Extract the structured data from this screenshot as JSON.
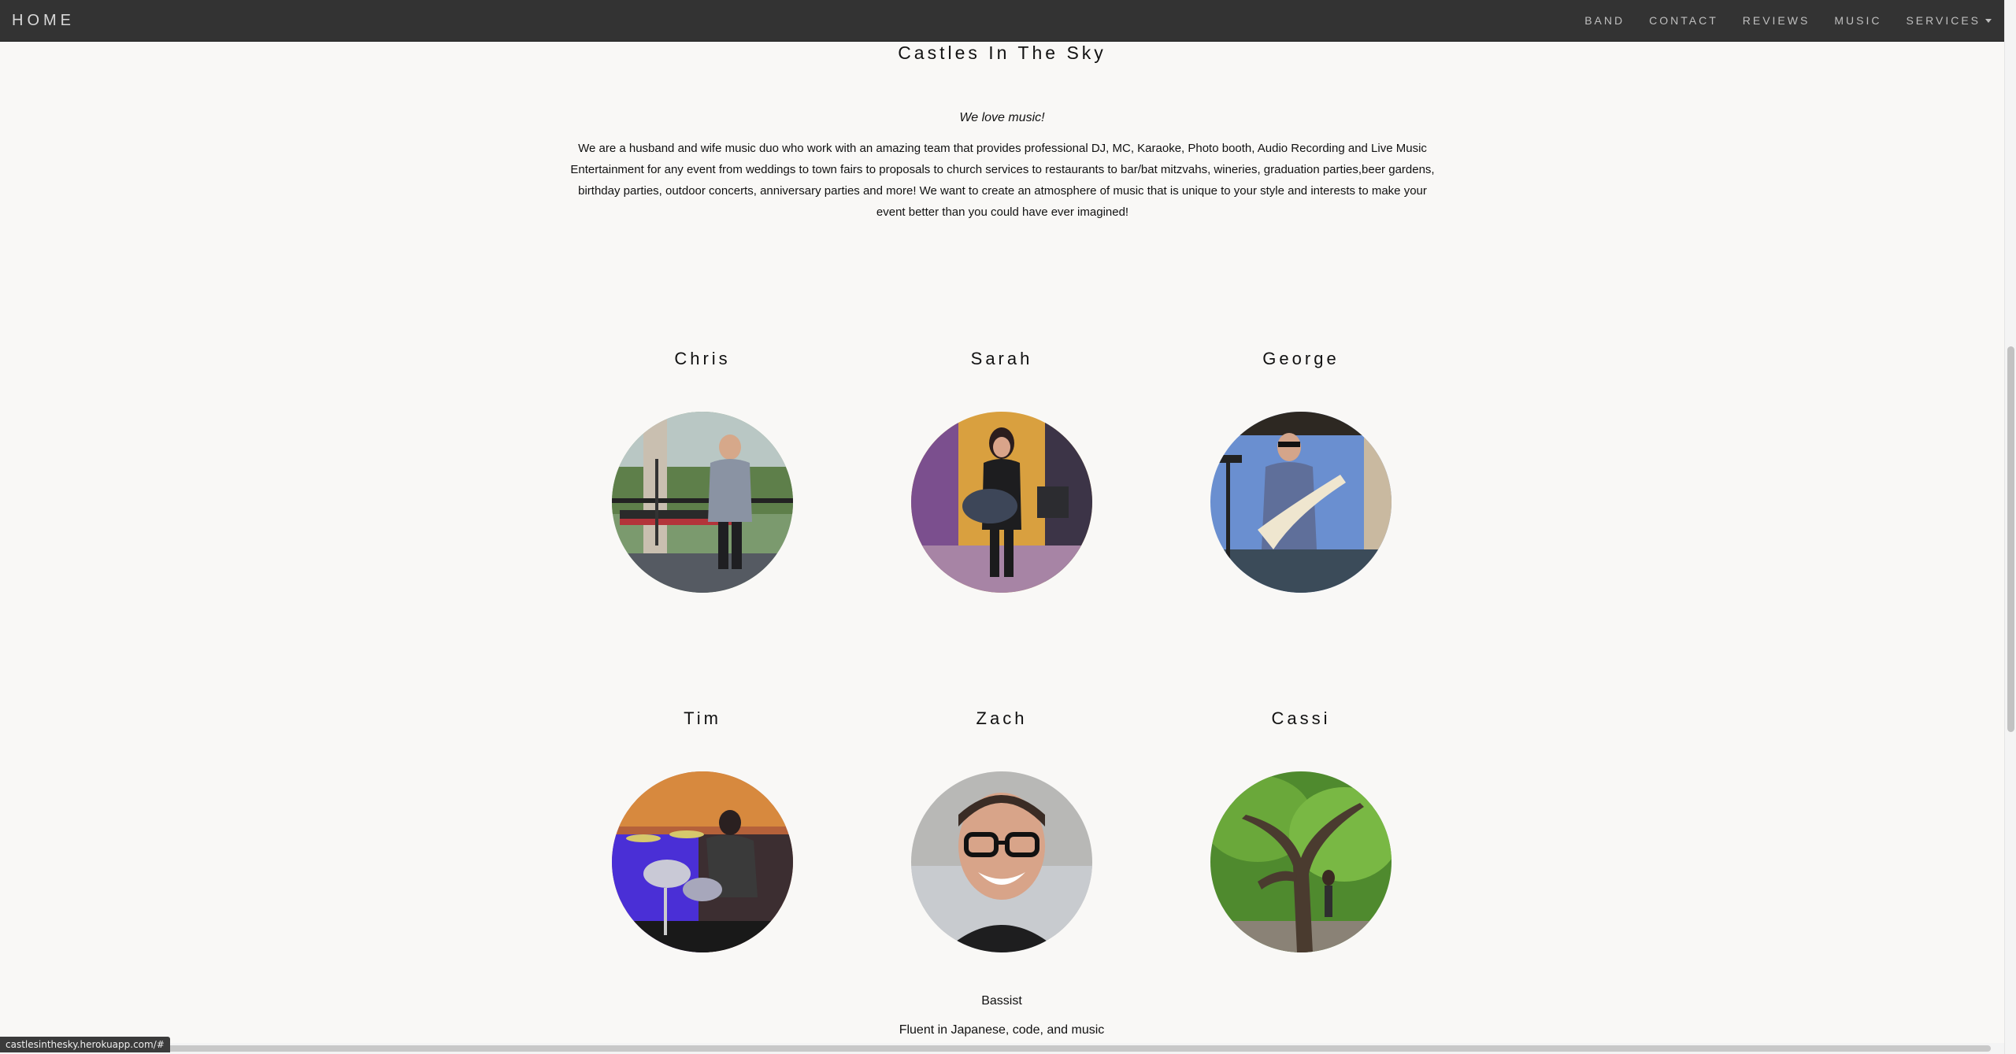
{
  "navbar": {
    "brand": "HOME",
    "items": [
      {
        "label": "BAND"
      },
      {
        "label": "CONTACT"
      },
      {
        "label": "REVIEWS"
      },
      {
        "label": "MUSIC"
      },
      {
        "label": "SERVICES"
      }
    ]
  },
  "page": {
    "title": "Castles In The Sky",
    "tagline": "We love music!",
    "intro": "We are a husband and wife music duo who work with an amazing team that provides professional DJ, MC, Karaoke, Photo booth, Audio Recording and Live Music Entertainment for any event from weddings to town fairs to proposals to church services to restaurants to bar/bat mitzvahs, wineries, graduation parties,beer gardens, birthday parties, outdoor concerts, anniversary parties and more! We want to create an atmosphere of music that is unique to your style and interests to make your event better than you could have ever imagined!"
  },
  "members": [
    {
      "name": "Chris"
    },
    {
      "name": "Sarah"
    },
    {
      "name": "George"
    },
    {
      "name": "Tim"
    },
    {
      "name": "Zach",
      "role": "Bassist",
      "bio": "Fluent in Japanese, code, and music"
    },
    {
      "name": "Cassi"
    }
  ],
  "status_bar": {
    "url": "castlesinthesky.herokuapp.com/#"
  },
  "colors": {
    "navbar_bg": "#333333",
    "page_bg": "#f9f8f6"
  }
}
